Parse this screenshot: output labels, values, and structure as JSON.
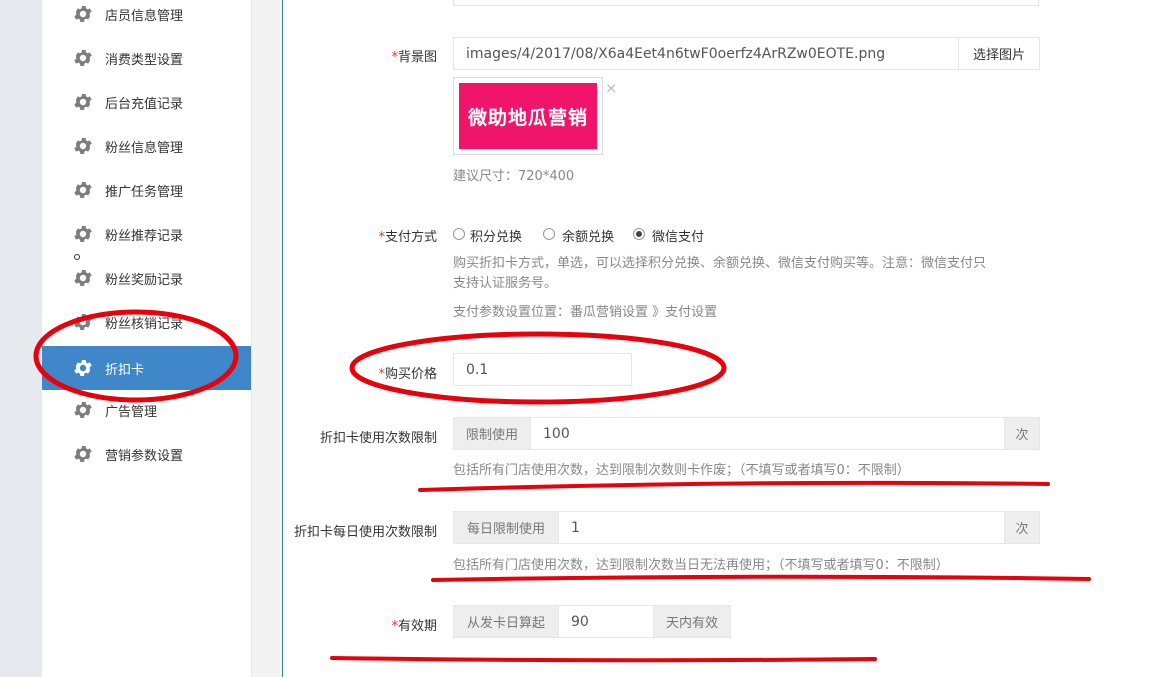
{
  "sidebar": {
    "items": [
      {
        "label": "店员信息管理",
        "active": false
      },
      {
        "label": "消费类型设置",
        "active": false
      },
      {
        "label": "后台充值记录",
        "active": false
      },
      {
        "label": "粉丝信息管理",
        "active": false
      },
      {
        "label": "推广任务管理",
        "active": false
      },
      {
        "label": "粉丝推荐记录",
        "active": false
      },
      {
        "label": "粉丝奖励记录",
        "active": false
      },
      {
        "label": "粉丝核销记录",
        "active": false
      },
      {
        "label": "折扣卡",
        "active": true
      },
      {
        "label": "广告管理",
        "active": false
      },
      {
        "label": "营销参数设置",
        "active": false
      }
    ],
    "icon": "gear-icon"
  },
  "form": {
    "required_mark": "*",
    "background": {
      "label": "背景图",
      "value": "images/4/2017/08/X6a4Eet4n6twF0oerfz4ArRZw0EOTE.png",
      "button": "选择图片",
      "preview_text": "微助地瓜营销",
      "remove": "×",
      "hint": "建议尺寸：720*400"
    },
    "payment": {
      "label": "支付方式",
      "options": [
        {
          "label": "积分兑换",
          "checked": false
        },
        {
          "label": "余额兑换",
          "checked": false
        },
        {
          "label": "微信支付",
          "checked": true
        }
      ],
      "help_line1": "购买折扣卡方式，单选，可以选择积分兑换、余额兑换、微信支付购买等。注意：微信支付只",
      "help_line2": "支持认证服务号。",
      "help_line3": "支付参数设置位置：番瓜营销设置 》支付设置"
    },
    "price": {
      "label": "购买价格",
      "value": "0.1"
    },
    "use_limit": {
      "label": "折扣卡使用次数限制",
      "prefix": "限制使用",
      "value": "100",
      "suffix": "次",
      "help": "包括所有门店使用次数，达到限制次数则卡作废；（不填写或者填写0：不限制）"
    },
    "daily_limit": {
      "label": "折扣卡每日使用次数限制",
      "prefix": "每日限制使用",
      "value": "1",
      "suffix": "次",
      "help": "包括所有门店使用次数，达到限制次数当日无法再使用；（不填写或者填写0：不限制）"
    },
    "validity": {
      "label": "有效期",
      "prefix": "从发卡日算起",
      "value": "90",
      "suffix": "天内有效"
    }
  },
  "colors": {
    "accent": "#3f87c9",
    "annotation": "#e8000b",
    "preview_bg": "#f0146a"
  }
}
